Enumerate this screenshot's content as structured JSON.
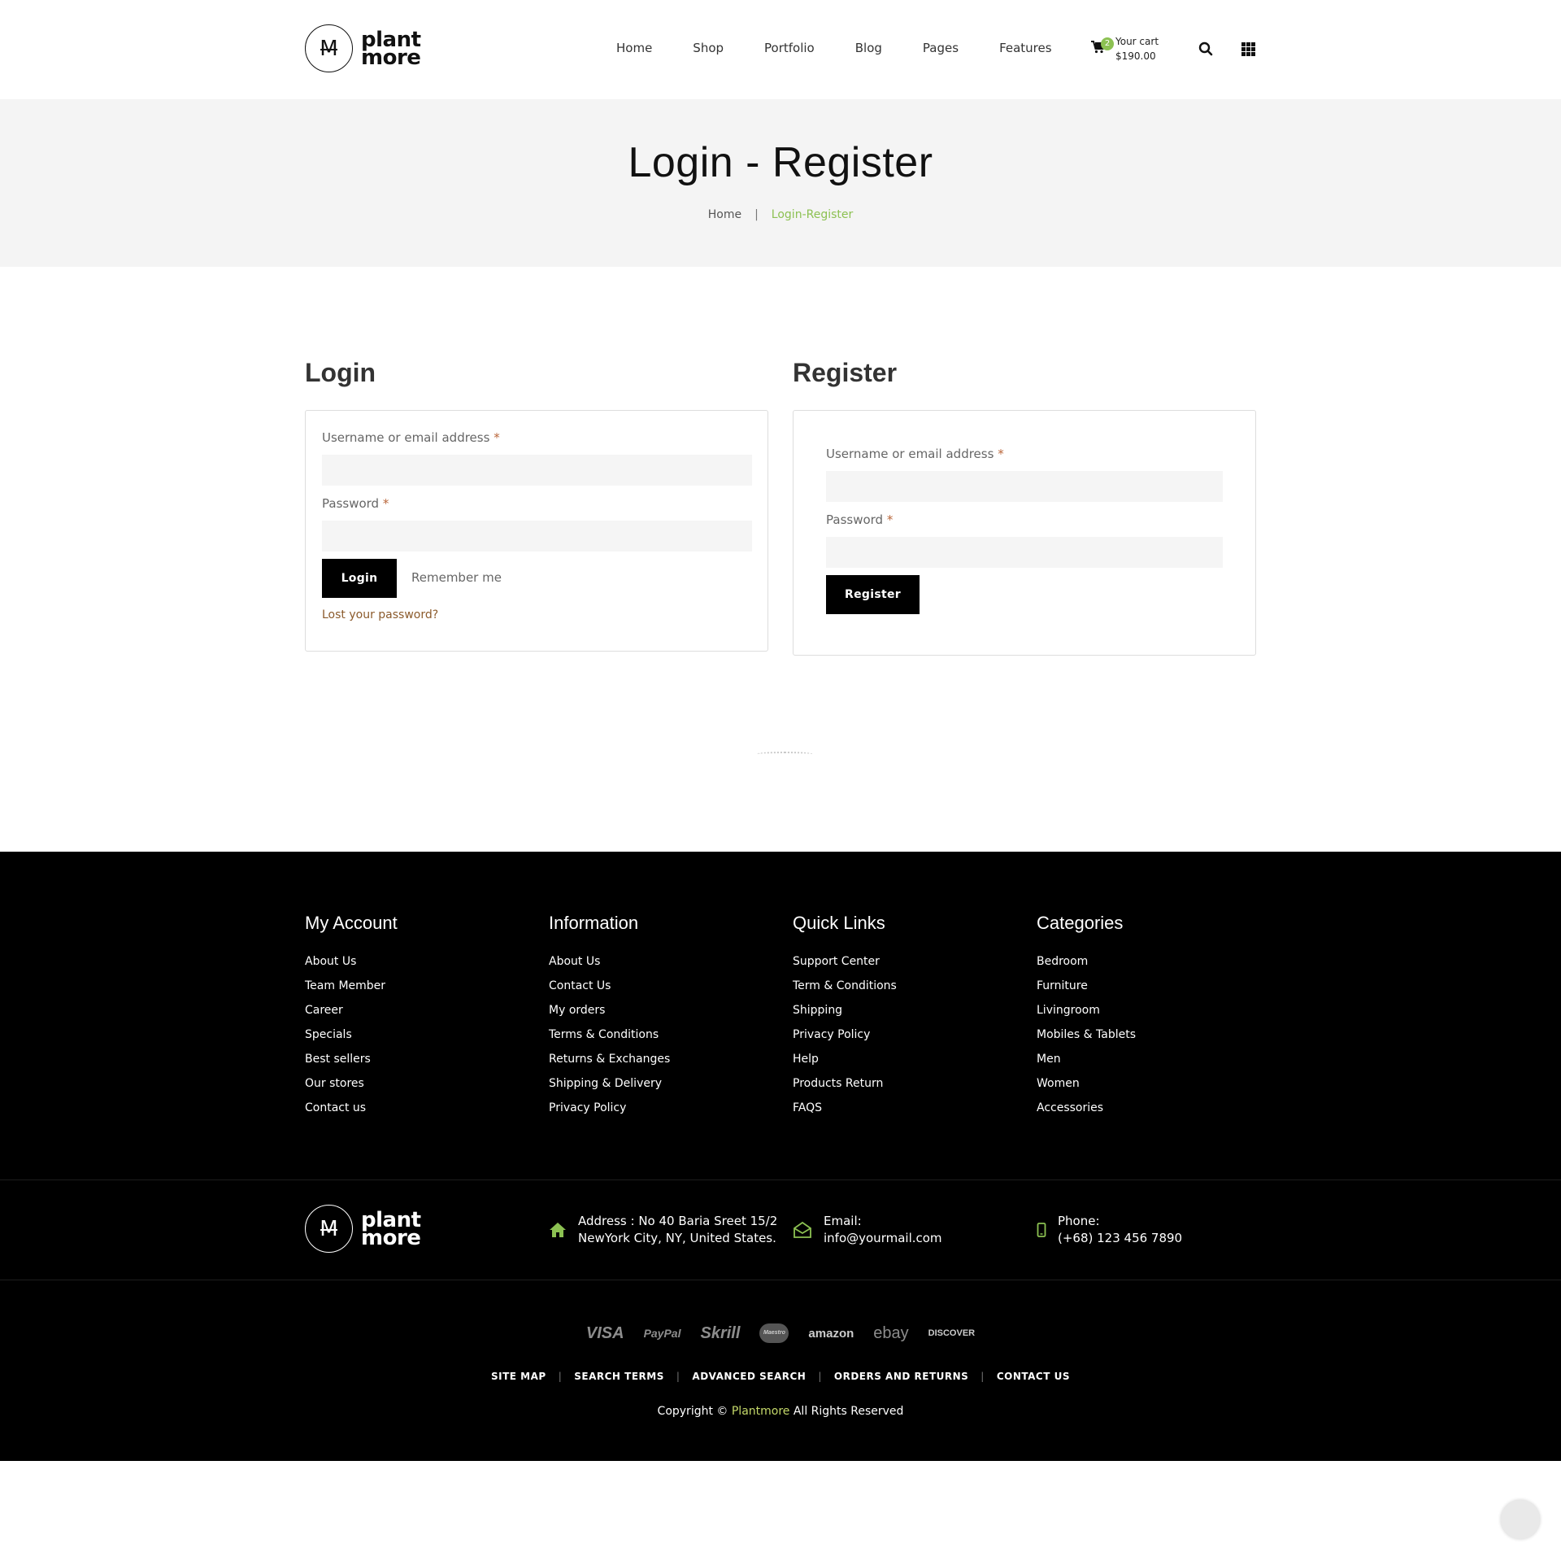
{
  "header": {
    "logo_line1": "plant",
    "logo_line2": "more",
    "logo_glyph": "M",
    "nav": [
      "Home",
      "Shop",
      "Portfolio",
      "Blog",
      "Pages",
      "Features"
    ],
    "cart": {
      "count": "2",
      "label": "Your cart",
      "total": "$190.00"
    }
  },
  "page_title": {
    "title": "Login - Register",
    "breadcrumb_home": "Home",
    "breadcrumb_sep": "|",
    "breadcrumb_current": "Login-Register"
  },
  "login": {
    "heading": "Login",
    "username_label": "Username or email address",
    "password_label": "Password",
    "required_mark": "*",
    "button": "Login",
    "remember": "Remember me",
    "lost_password": "Lost your password?"
  },
  "register": {
    "heading": "Register",
    "username_label": "Username or email address",
    "password_label": "Password",
    "required_mark": "*",
    "button": "Register"
  },
  "footer": {
    "columns": [
      {
        "title": "My Account",
        "items": [
          "About Us",
          "Team Member",
          "Career",
          "Specials",
          "Best sellers",
          "Our stores",
          "Contact us"
        ]
      },
      {
        "title": "Information",
        "items": [
          "About Us",
          "Contact Us",
          "My orders",
          "Terms & Conditions",
          "Returns & Exchanges",
          "Shipping & Delivery",
          "Privacy Policy"
        ]
      },
      {
        "title": "Quick Links",
        "items": [
          "Support Center",
          "Term & Conditions",
          "Shipping",
          "Privacy Policy",
          "Help",
          "Products Return",
          "FAQS"
        ]
      },
      {
        "title": "Categories",
        "items": [
          "Bedroom",
          "Furniture",
          "Livingroom",
          "Mobiles & Tablets",
          "Men",
          "Women",
          "Accessories"
        ]
      }
    ],
    "address_line1": "Address : No 40 Baria Sreet 15/2",
    "address_line2": "NewYork City, NY, United States.",
    "email_label": "Email:",
    "email": "info@yourmail.com",
    "phone_label": "Phone:",
    "phone": "(+68) 123 456 7890",
    "payments": [
      "VISA",
      "PayPal",
      "Skrill",
      "Maestro",
      "amazon",
      "ebay",
      "DISCOVER"
    ],
    "links": [
      "SITE MAP",
      "SEARCH TERMS",
      "ADVANCED SEARCH",
      "ORDERS AND RETURNS",
      "CONTACT US"
    ],
    "copyright_prefix": "Copyright ©",
    "copyright_brand": "Plantmore",
    "copyright_suffix": "All Rights Reserved"
  },
  "colors": {
    "accent": "#8cc152",
    "link_brown": "#8b5a2b",
    "required": "#b9663a",
    "brand_footer": "#c5d96a"
  }
}
